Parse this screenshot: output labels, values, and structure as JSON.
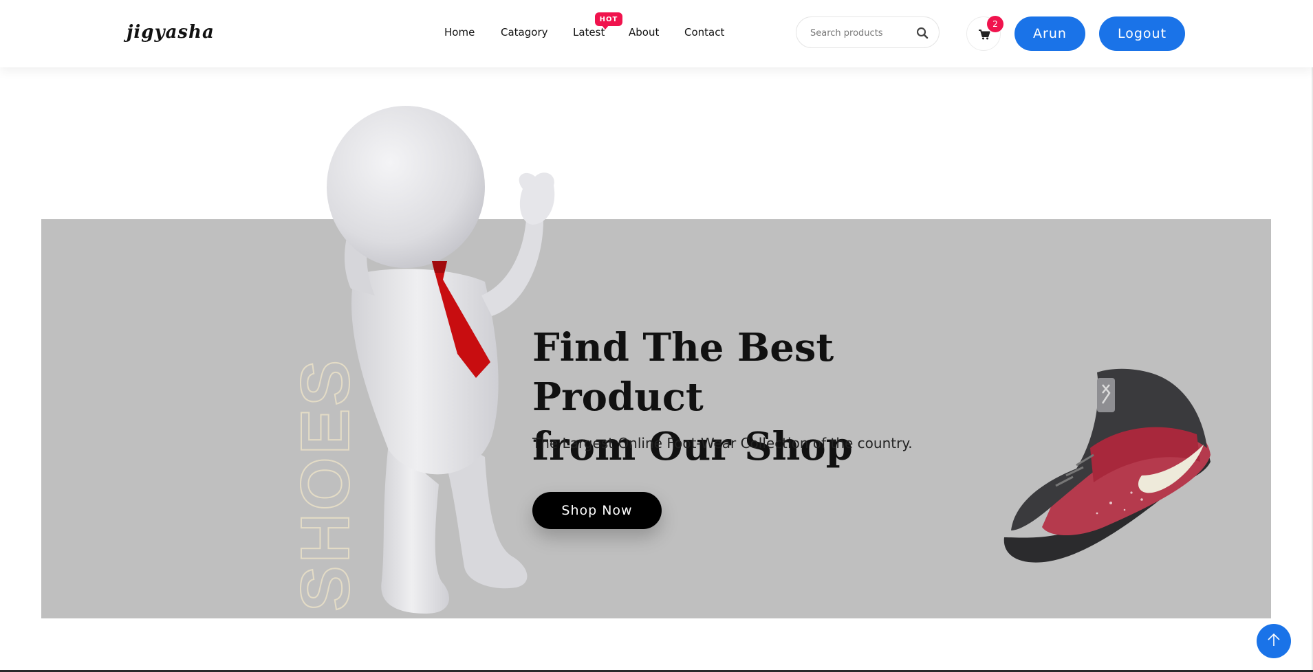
{
  "header": {
    "logo": "jigyasha",
    "nav": [
      {
        "label": "Home"
      },
      {
        "label": "Catagory"
      },
      {
        "label": "Latest",
        "badge": "HOT"
      },
      {
        "label": "About"
      },
      {
        "label": "Contact"
      }
    ],
    "search": {
      "placeholder": "Search products",
      "value": ""
    },
    "cart": {
      "count": "2",
      "icon": "cart-icon"
    },
    "user_label": "Arun",
    "logout_label": "Logout"
  },
  "hero": {
    "vertical_word": "SHOES",
    "headline_line1": "Find The Best Product",
    "headline_line2": "from Our Shop",
    "subline": "The Largest Online Foot-Wear Collection of the country.",
    "cta_label": "Shop Now"
  },
  "colors": {
    "accent": "#1a73e8",
    "badge": "#f0134d",
    "hero_bg": "#bfbfbf",
    "cta_bg": "#000000"
  },
  "icons": {
    "search": "search-icon",
    "cart": "cart-icon",
    "scroll_top": "arrow-up-icon"
  }
}
